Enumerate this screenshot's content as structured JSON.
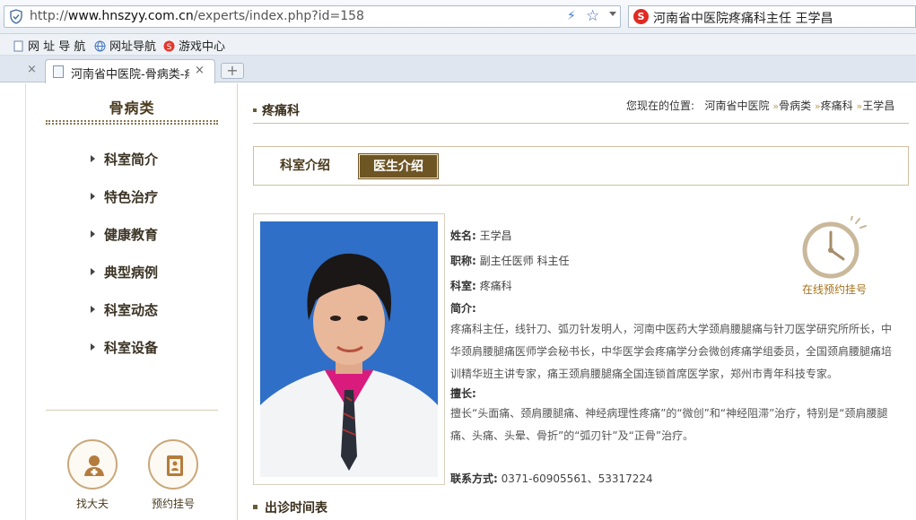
{
  "browser": {
    "url_prefix": "http://",
    "url_host": "www.hnszyy.com.cn",
    "url_path": "/experts/index.php?id=158",
    "search_text": "河南省中医院疼痛科主任 王学昌",
    "favorites": [
      "网 址 导 航",
      "网址导航",
      "游戏中心"
    ],
    "active_tab_title": "河南省中医院-骨病类-疼",
    "new_tab_symbol": "+",
    "close_symbol": "×"
  },
  "sidebar": {
    "title": "骨病类",
    "menu": [
      "科室简介",
      "特色治疗",
      "健康教育",
      "典型病例",
      "科室动态",
      "科室设备"
    ],
    "find_doctor": "找大夫",
    "book": "预约挂号"
  },
  "main": {
    "section_title": "疼痛科",
    "breadcrumb_prefix": "您现在的位置:",
    "breadcrumb": [
      "河南省中医院",
      "骨病类",
      "疼痛科",
      "王学昌"
    ],
    "breadcrumb_sep": "»",
    "tabs": [
      {
        "label": "科室介绍",
        "active": false
      },
      {
        "label": "医生介绍",
        "active": true
      }
    ],
    "online_booking": "在线预约挂号",
    "schedule_title": "出诊时间表"
  },
  "doctor": {
    "name_label": "姓名:",
    "name": "王学昌",
    "title_label": "职称:",
    "title": "副主任医师 科主任",
    "dept_label": "科室:",
    "dept": "疼痛科",
    "intro_label": "简介:",
    "intro": "疼痛科主任，线针刀、弧刃针发明人，河南中医药大学颈肩腰腿痛与针刀医学研究所所长，中华颈肩腰腿痛医师学会秘书长，中华医学会疼痛学分会微创疼痛学组委员，全国颈肩腰腿痛培训精华班主讲专家，痛王颈肩腰腿痛全国连锁首席医学家，郑州市青年科技专家。",
    "specialty_label": "擅长:",
    "specialty": "擅长“头面痛、颈肩腰腿痛、神经病理性疼痛”的“微创”和“神经阻滞”治疗，特别是“颈肩腰腿痛、头痛、头晕、骨折”的“弧刃针”及“正骨”治疗。",
    "contact_label": "联系方式:",
    "contact": "0371-60905561、53317224"
  },
  "colors": {
    "accent_brown": "#6e5524",
    "gold_link": "#a4731e",
    "photo_bg": "#2f6fc7"
  }
}
